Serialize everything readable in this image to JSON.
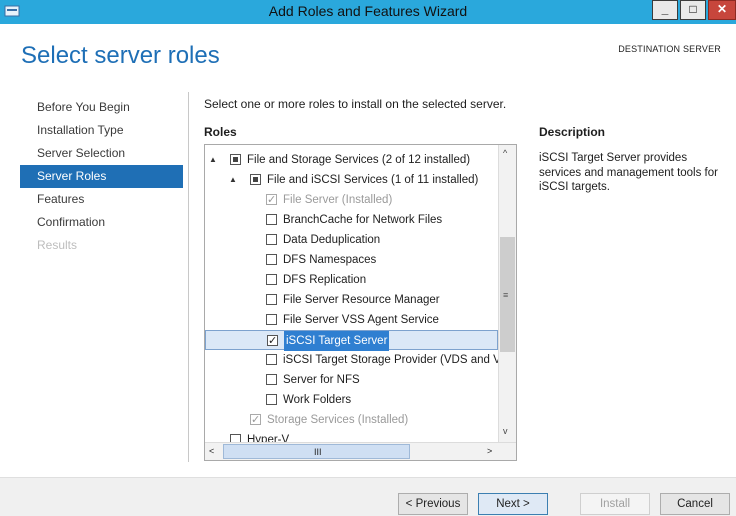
{
  "window": {
    "title": "Add Roles and Features Wizard",
    "min_glyph": "_",
    "max_glyph": "□",
    "close_glyph": "✕"
  },
  "page": {
    "title": "Select server roles",
    "destination": "DESTINATION SERVER"
  },
  "nav": [
    {
      "label": "Before You Begin",
      "state": "normal"
    },
    {
      "label": "Installation Type",
      "state": "normal"
    },
    {
      "label": "Server Selection",
      "state": "normal"
    },
    {
      "label": "Server Roles",
      "state": "active"
    },
    {
      "label": "Features",
      "state": "normal"
    },
    {
      "label": "Confirmation",
      "state": "normal"
    },
    {
      "label": "Results",
      "state": "disabled"
    }
  ],
  "main": {
    "instruction": "Select one or more roles to install on the selected server.",
    "roles_label": "Roles",
    "description_label": "Description",
    "description_text": "iSCSI Target Server provides services and management tools for iSCSI targets."
  },
  "roles_tree": [
    {
      "label": "File and Storage Services (2 of 12 installed)",
      "indent": 0,
      "expander": "▲",
      "check": "partial",
      "disabled": false,
      "selected": false
    },
    {
      "label": "File and iSCSI Services (1 of 11 installed)",
      "indent": 1,
      "expander": "▲",
      "check": "partial",
      "disabled": false,
      "selected": false
    },
    {
      "label": "File Server (Installed)",
      "indent": 2,
      "expander": "",
      "check": "checked",
      "disabled": true,
      "selected": false
    },
    {
      "label": "BranchCache for Network Files",
      "indent": 2,
      "expander": "",
      "check": "unchecked",
      "disabled": false,
      "selected": false
    },
    {
      "label": "Data Deduplication",
      "indent": 2,
      "expander": "",
      "check": "unchecked",
      "disabled": false,
      "selected": false
    },
    {
      "label": "DFS Namespaces",
      "indent": 2,
      "expander": "",
      "check": "unchecked",
      "disabled": false,
      "selected": false
    },
    {
      "label": "DFS Replication",
      "indent": 2,
      "expander": "",
      "check": "unchecked",
      "disabled": false,
      "selected": false
    },
    {
      "label": "File Server Resource Manager",
      "indent": 2,
      "expander": "",
      "check": "unchecked",
      "disabled": false,
      "selected": false
    },
    {
      "label": "File Server VSS Agent Service",
      "indent": 2,
      "expander": "",
      "check": "unchecked",
      "disabled": false,
      "selected": false
    },
    {
      "label": "iSCSI Target Server",
      "indent": 2,
      "expander": "",
      "check": "checked",
      "disabled": false,
      "selected": true
    },
    {
      "label": "iSCSI Target Storage Provider (VDS and VSS",
      "indent": 2,
      "expander": "",
      "check": "unchecked",
      "disabled": false,
      "selected": false
    },
    {
      "label": "Server for NFS",
      "indent": 2,
      "expander": "",
      "check": "unchecked",
      "disabled": false,
      "selected": false
    },
    {
      "label": "Work Folders",
      "indent": 2,
      "expander": "",
      "check": "unchecked",
      "disabled": false,
      "selected": false
    },
    {
      "label": "Storage Services (Installed)",
      "indent": 1,
      "expander": "",
      "check": "checked",
      "disabled": true,
      "selected": false
    },
    {
      "label": "Hyper-V",
      "indent": 0,
      "expander": "",
      "check": "unchecked",
      "disabled": false,
      "selected": false
    }
  ],
  "scrollbar": {
    "up": "^",
    "down": "v",
    "left": "<",
    "right": ">",
    "grip_v": "≡",
    "grip_h": "III"
  },
  "footer": {
    "previous": "< Previous",
    "next": "Next >",
    "install": "Install",
    "cancel": "Cancel"
  }
}
